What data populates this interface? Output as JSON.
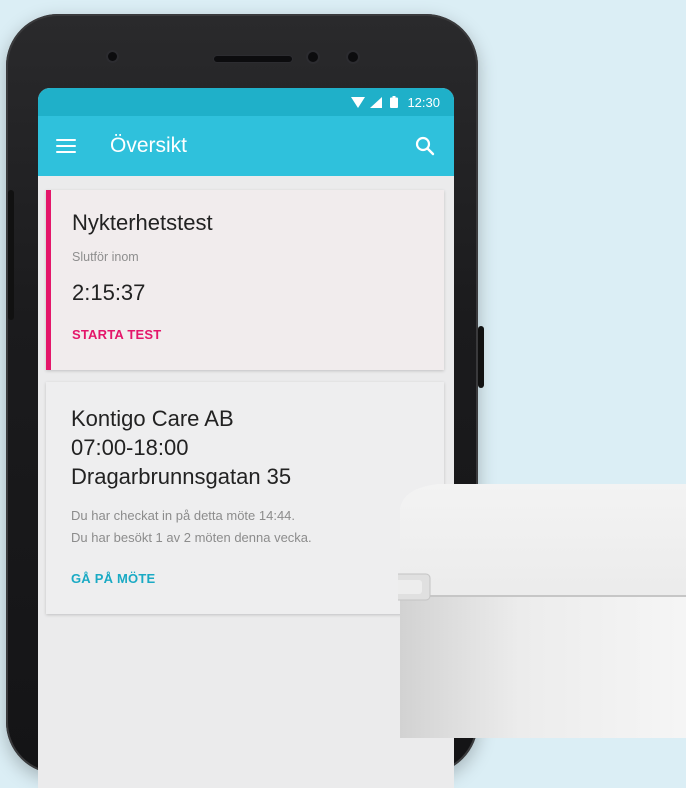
{
  "statusbar": {
    "time": "12:30",
    "icons": [
      "wifi-icon",
      "signal-icon",
      "battery-icon"
    ]
  },
  "appbar": {
    "title": "Översikt",
    "icons": [
      "menu-icon",
      "search-icon"
    ]
  },
  "cards": [
    {
      "title": "Nykterhetstest",
      "subtitle": "Slutför inom",
      "timer": "2:15:37",
      "action": "STARTA TEST"
    },
    {
      "lines": [
        "Kontigo Care AB",
        "07:00-18:00",
        "Dragarbrunnsgatan 35"
      ],
      "info": [
        "Du har checkat in på detta möte 14:44.",
        "Du har besökt 1 av 2 möten denna vecka."
      ],
      "action": "GÅ PÅ MÖTE"
    }
  ],
  "colors": {
    "background": "#dbeef5",
    "statusbar": "#1fb0c9",
    "appbar": "#2fc1dc",
    "accent_pink": "#e4166a",
    "accent_cyan": "#1aaac4"
  }
}
